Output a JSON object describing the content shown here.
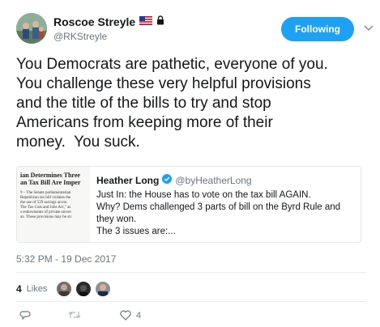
{
  "user": {
    "display_name": "Roscoe Streyle",
    "handle": "@RKStreyle",
    "flag_icon": "us-flag-icon",
    "lock_icon": "lock-icon"
  },
  "follow_button": {
    "label": "Following"
  },
  "tweet": {
    "text": "You Democrats are pathetic, everyone of you.\nYou challenge these very helpful provisions\nand the title of the bills to try and stop\nAmericans from keeping more of their\nmoney.  You suck."
  },
  "quoted_tweet": {
    "thumbnail_headline": "ian Determines Three\nan Tax Bill Are Imper",
    "thumbnail_body": "9 – The Senate parliamentarian\nRepublican tax bill violates the\nthe use of 529 savings accou\nThe Tax Cuts and Jobs Act,\" as\ns endowments of private univer\nax. These provisions may be str",
    "author_name": "Heather Long",
    "author_handle": "@byHeatherLong",
    "verified_icon": "verified-badge-icon",
    "text": "Just In: the House has to vote on the tax bill AGAIN.\nWhy? Dems challenged 3 parts of bill on the Byrd Rule and they won.\nThe 3 issues are:..."
  },
  "timestamp": "5:32 PM - 19 Dec 2017",
  "likes": {
    "count": "4",
    "label": "Likes"
  },
  "actions": {
    "reply_icon": "reply-icon",
    "retweet_icon": "retweet-icon",
    "like_icon": "heart-icon",
    "like_count": "4"
  },
  "colors": {
    "accent": "#1da1f2",
    "text": "#14171a",
    "secondary": "#657786",
    "border": "#e1e8ed"
  }
}
